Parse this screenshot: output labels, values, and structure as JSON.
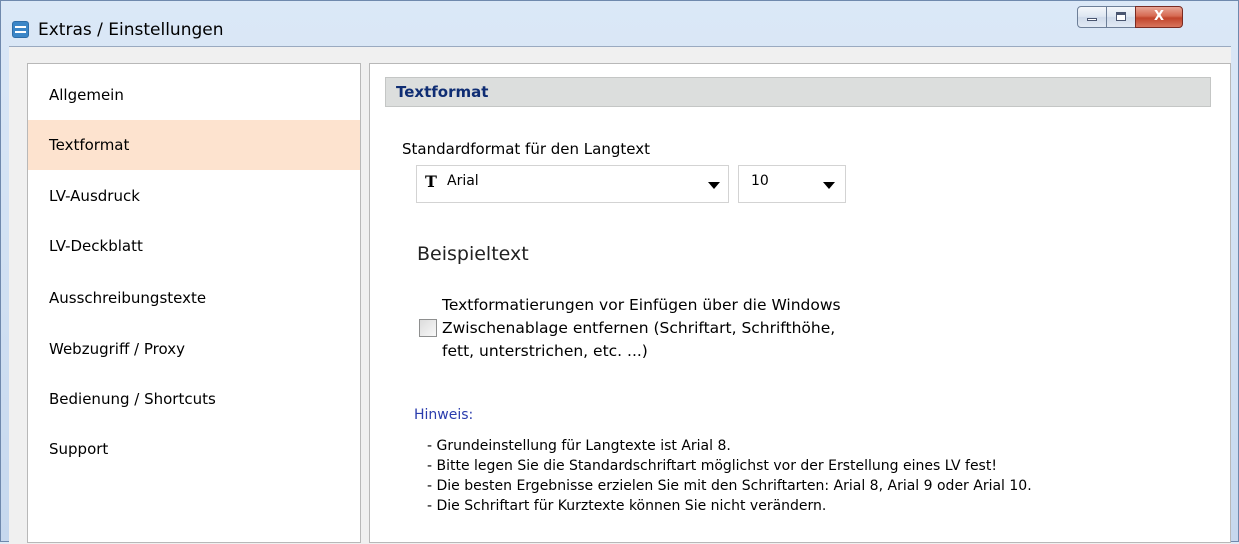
{
  "window": {
    "title": "Extras / Einstellungen",
    "controls": {
      "close_label": "X"
    }
  },
  "sidebar": {
    "items": [
      {
        "label": "Allgemein",
        "active": false
      },
      {
        "label": "Textformat",
        "active": true
      },
      {
        "label": "LV-Ausdruck",
        "active": false
      },
      {
        "label": "LV-Deckblatt",
        "active": false
      },
      {
        "label": "Ausschreibungstexte",
        "active": false
      },
      {
        "label": "Webzugriff / Proxy",
        "active": false
      },
      {
        "label": "Bedienung / Shortcuts",
        "active": false
      },
      {
        "label": "Support",
        "active": false
      }
    ]
  },
  "content": {
    "section_title": "Textformat",
    "std_format_label": "Standardformat für den Langtext",
    "font_select": {
      "icon": "truetype-font-icon",
      "icon_glyph": "T",
      "value": "Arial"
    },
    "size_select": {
      "value": "10"
    },
    "example_text": "Beispieltext",
    "checkbox": {
      "checked": false,
      "label": "Textformatierungen vor Einfügen über die Windows\nZwischenablage entfernen (Schriftart, Schrifthöhe,\nfett, unterstrichen, etc. ...)"
    },
    "hint": {
      "title": "Hinweis:",
      "lines": [
        "- Grundeinstellung für Langtexte ist Arial 8.",
        "- Bitte legen Sie die Standardschriftart möglichst vor der Erstellung eines LV fest!",
        "- Die besten Ergebnisse erzielen Sie mit den Schriftarten: Arial 8, Arial 9 oder Arial 10.",
        "- Die Schriftart für Kurztexte können Sie nicht verändern."
      ]
    }
  },
  "colors": {
    "active_nav_bg": "#fde3cf",
    "section_title_color": "#0f2d73",
    "hint_title_color": "#2a3cad",
    "close_button": "#c1442b"
  }
}
